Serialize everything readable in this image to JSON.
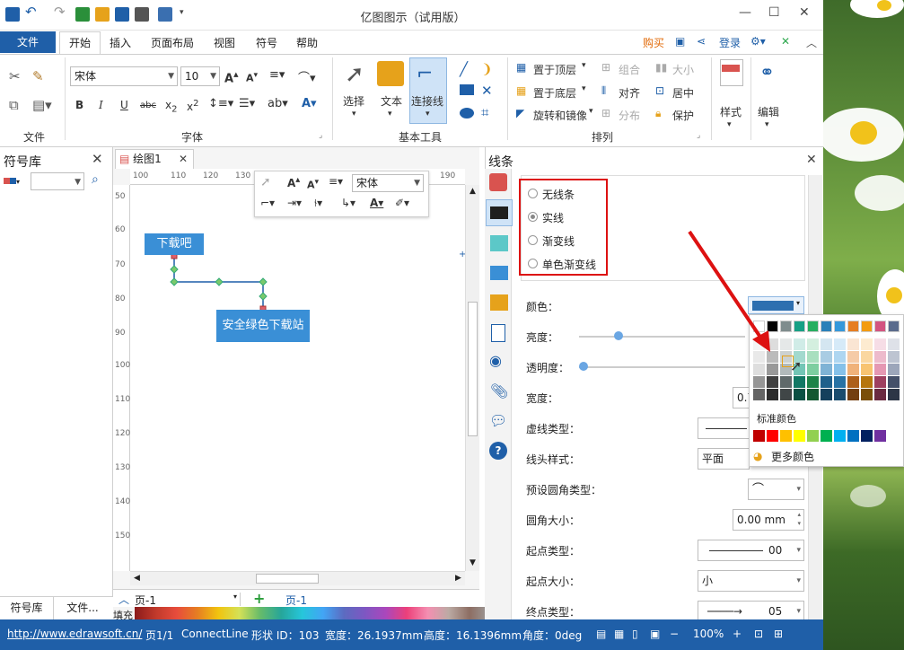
{
  "window": {
    "title": "亿图图示（试用版）"
  },
  "menu": {
    "file": "文件",
    "tabs": [
      "开始",
      "插入",
      "页面布局",
      "视图",
      "符号",
      "帮助"
    ],
    "right": {
      "buy": "购买",
      "login": "登录"
    }
  },
  "ribbon": {
    "font_name": "宋体",
    "font_size": "10",
    "groups": {
      "file": "文件",
      "font": "字体",
      "basic_tools": "基本工具",
      "arrange": "排列"
    },
    "tools": {
      "select": "选择",
      "text": "文本",
      "connector": "连接线"
    },
    "arrange": {
      "bring_top": "置于顶层",
      "send_bottom": "置于底层",
      "rotate_mirror": "旋转和镜像",
      "group": "组合",
      "align": "对齐",
      "distribute": "分布",
      "size": "大小",
      "center": "居中",
      "protect": "保护"
    },
    "style": "样式",
    "edit": "编辑"
  },
  "left_panel": {
    "title": "符号库",
    "tabs": [
      "符号库",
      "文件..."
    ]
  },
  "document": {
    "tab": "绘图1",
    "ruler_h": [
      "100",
      "110",
      "120",
      "130",
      "190"
    ],
    "ruler_v": [
      "50",
      "60",
      "70",
      "80",
      "90",
      "100",
      "110",
      "120",
      "130",
      "140",
      "150"
    ],
    "shapes": {
      "a": "下载吧",
      "b": "安全绿色下载站"
    },
    "mini_font": "宋体",
    "page_label": "页-1",
    "page_tab": "页-1",
    "fill_label": "填充"
  },
  "properties": {
    "title": "线条",
    "line_options": [
      "无线条",
      "实线",
      "渐变线",
      "单色渐变线"
    ],
    "selected_option": "实线",
    "fields": {
      "color": "颜色：",
      "brightness": "亮度：",
      "transparency": "透明度：",
      "width": "宽度：",
      "dash_type": "虚线类型：",
      "cap_style": "线头样式：",
      "preset_corner": "预设圆角类型：",
      "corner_size": "圆角大小：",
      "start_type": "起点类型：",
      "start_size": "起点大小：",
      "end_type": "终点类型："
    },
    "values": {
      "width": "0.7",
      "cap_style": "平面",
      "corner_size": "0.00 mm",
      "start_type": "00",
      "start_size": "小",
      "end_type": "05"
    },
    "line_color": "#2d6fb0",
    "brightness_level": 0.25,
    "transparency_level": 0.0
  },
  "color_popup": {
    "standard_label": "标准颜色",
    "more_label": "更多颜色",
    "top_row": [
      "#ffffff",
      "#000000",
      "#7f8c8d",
      "#16a085",
      "#27ae60",
      "#2980b9",
      "#3498db",
      "#e67e22",
      "#f39c12",
      "#d35480",
      "#5a6b8c"
    ],
    "standard": [
      "#c00000",
      "#ff0000",
      "#ffc000",
      "#ffff00",
      "#92d050",
      "#00b050",
      "#00b0f0",
      "#0070c0",
      "#002060",
      "#7030a0"
    ]
  },
  "status": {
    "url": "http://www.edrawsoft.cn/",
    "page": "页1/1",
    "type": "ConnectLine",
    "shape_id": "形状 ID：103",
    "width": "宽度：26.1937mm",
    "height": "高度：16.1396mm",
    "angle": "角度：0deg",
    "zoom": "100%"
  }
}
